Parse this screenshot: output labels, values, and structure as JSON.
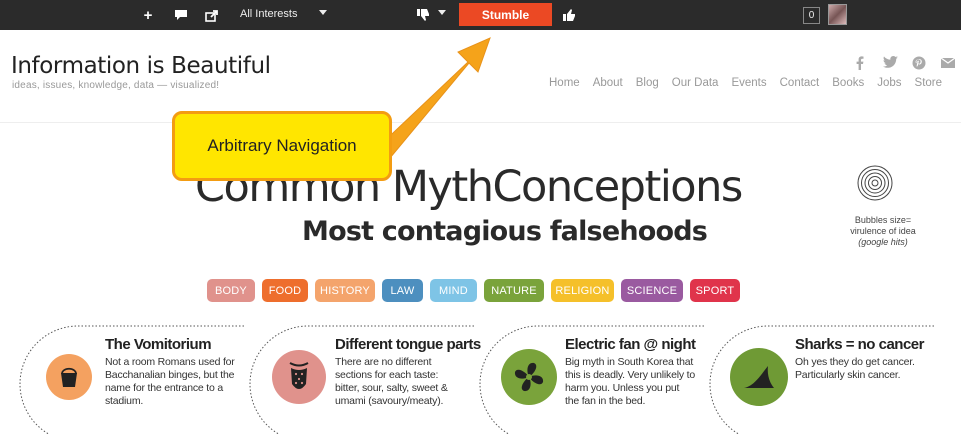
{
  "toolbar": {
    "interests_label": "All Interests",
    "stumble_label": "Stumble",
    "count": "0"
  },
  "site": {
    "title": "Information is Beautiful",
    "tagline": "ideas, issues, knowledge, data — visualized!",
    "nav": [
      "Home",
      "About",
      "Blog",
      "Our Data",
      "Events",
      "Contact",
      "Books",
      "Jobs",
      "Store"
    ],
    "social": [
      "facebook-icon",
      "twitter-icon",
      "pinterest-icon",
      "mail-icon"
    ]
  },
  "page": {
    "title": "Common MythConceptions",
    "subtitle": "Most contagious falsehoods",
    "legend_line1": "Bubbles size=",
    "legend_line2": "virulence of idea",
    "legend_line3": "(google hits)"
  },
  "categories": [
    {
      "label": "BODY",
      "color": "#e0928c"
    },
    {
      "label": "FOOD",
      "color": "#ee6e2d"
    },
    {
      "label": "HISTORY",
      "color": "#f4a46c"
    },
    {
      "label": "LAW",
      "color": "#4d8fbf"
    },
    {
      "label": "MIND",
      "color": "#7ec4e6"
    },
    {
      "label": "NATURE",
      "color": "#7aa33b"
    },
    {
      "label": "RELIGION",
      "color": "#f5c02a"
    },
    {
      "label": "SCIENCE",
      "color": "#9a5aa0"
    },
    {
      "label": "SPORT",
      "color": "#e0344b"
    }
  ],
  "myths": [
    {
      "title": "The Vomitorium",
      "body": "Not a room Romans used for Bacchanalian binges, but the name for the entrance to a stadium.",
      "color": "#f4a160",
      "icon": "bucket-icon"
    },
    {
      "title": "Different tongue parts",
      "body": "There are no different sections for each taste: bitter, sour, salty, sweet & umami (savoury/meaty).",
      "color": "#e0928c",
      "icon": "tongue-icon"
    },
    {
      "title": "Electric fan @ night",
      "body": "Big myth in South Korea that this is deadly. Very unlikely to harm you. Unless you put the fan in the bed.",
      "color": "#7aa33b",
      "icon": "fan-icon"
    },
    {
      "title": "Sharks = no cancer",
      "body": "Oh yes they do get cancer. Particularly skin cancer.",
      "color": "#6f9a35",
      "icon": "shark-fin-icon"
    }
  ],
  "annotation": {
    "text": "Arbitrary Navigation"
  }
}
